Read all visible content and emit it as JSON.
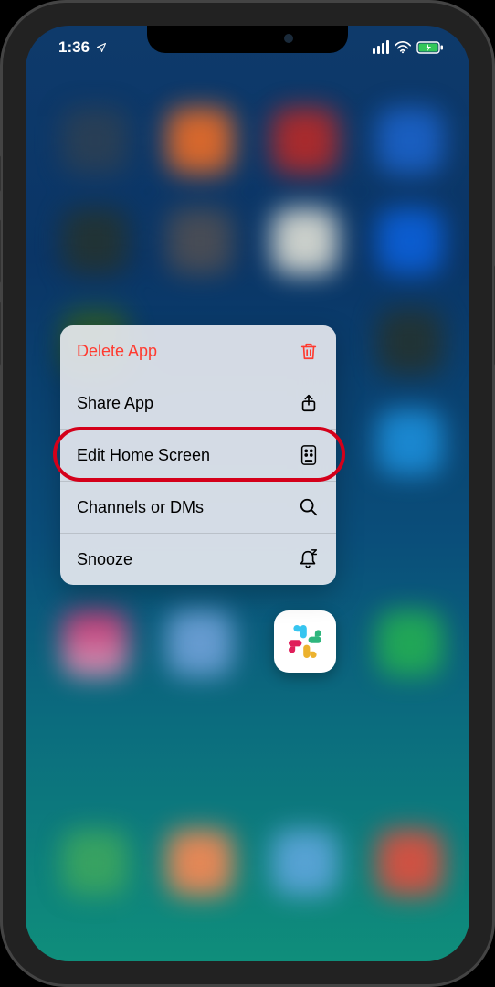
{
  "status": {
    "time": "1:36"
  },
  "menu": {
    "delete_label": "Delete App",
    "share_label": "Share App",
    "edit_label": "Edit Home Screen",
    "channels_label": "Channels or DMs",
    "snooze_label": "Snooze"
  },
  "app": {
    "name": "Slack"
  },
  "colors": {
    "destructive": "#ff3b30",
    "highlight": "#d4001a"
  }
}
